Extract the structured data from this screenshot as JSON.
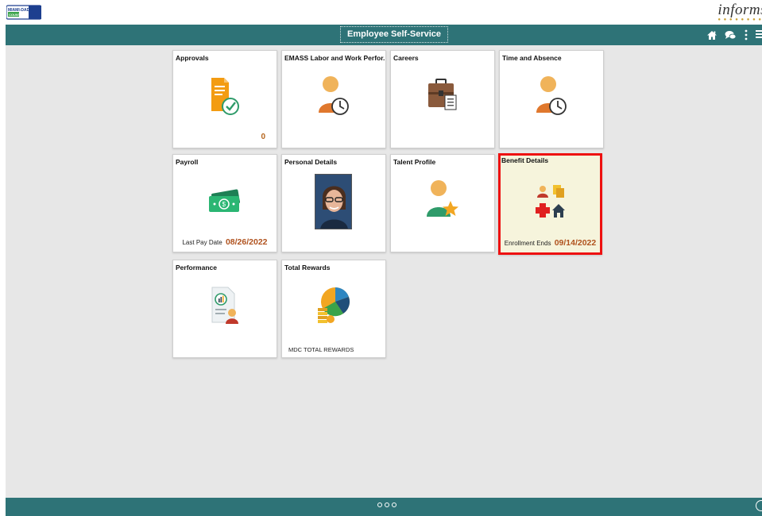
{
  "header": {
    "brand": "informs",
    "title": "Employee Self-Service"
  },
  "nav_icons": [
    "home-icon",
    "chat-icon",
    "more-vert-icon",
    "menu-icon"
  ],
  "tiles": [
    {
      "title": "Approvals",
      "count": "0"
    },
    {
      "title": "EMASS Labor and Work Perfor..."
    },
    {
      "title": "Careers"
    },
    {
      "title": "Time and Absence"
    },
    {
      "title": "Payroll",
      "footer_label": "Last Pay Date",
      "footer_value": "08/26/2022"
    },
    {
      "title": "Personal Details"
    },
    {
      "title": "Talent Profile"
    },
    {
      "title": "Benefit Details",
      "footer_label": "Enrollment Ends",
      "footer_value": "09/14/2022"
    },
    {
      "title": "Performance"
    },
    {
      "title": "Total Rewards",
      "footer_label": "MDC TOTAL REWARDS"
    }
  ],
  "colors": {
    "nav_bg": "#2e7377",
    "canvas_bg": "#e7e7e7",
    "highlight_border": "#ee1111",
    "value_orange": "#b0521e"
  }
}
